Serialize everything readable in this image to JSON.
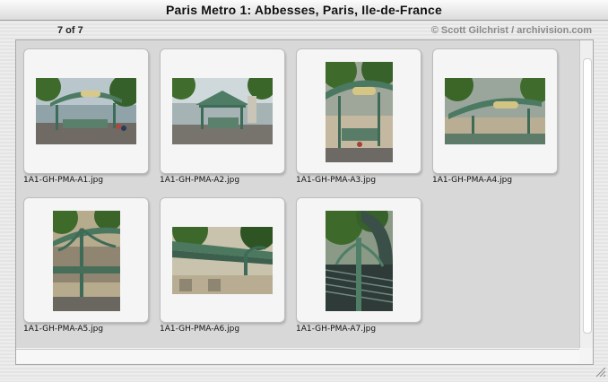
{
  "window": {
    "title": "Paris Metro 1: Abbesses, Paris, Ile-de-France"
  },
  "header": {
    "counter": "7 of 7",
    "copyright": "© Scott Gilchrist / archivision.com"
  },
  "gallery": {
    "items": [
      {
        "filename": "1A1-GH-PMA-A1.jpg",
        "orientation": "landscape",
        "icon": "photo-thumbnail-icon"
      },
      {
        "filename": "1A1-GH-PMA-A2.jpg",
        "orientation": "landscape",
        "icon": "photo-thumbnail-icon"
      },
      {
        "filename": "1A1-GH-PMA-A3.jpg",
        "orientation": "portrait",
        "icon": "photo-thumbnail-icon"
      },
      {
        "filename": "1A1-GH-PMA-A4.jpg",
        "orientation": "landscape",
        "icon": "photo-thumbnail-icon"
      },
      {
        "filename": "1A1-GH-PMA-A5.jpg",
        "orientation": "portrait",
        "icon": "photo-thumbnail-icon"
      },
      {
        "filename": "1A1-GH-PMA-A6.jpg",
        "orientation": "landscape",
        "icon": "photo-thumbnail-icon"
      },
      {
        "filename": "1A1-GH-PMA-A7.jpg",
        "orientation": "portrait",
        "icon": "photo-thumbnail-icon"
      }
    ]
  },
  "colors": {
    "background": "#e8e8e8",
    "gallery_background": "#d8d8d8",
    "card": "#f5f5f5",
    "metro_green": "#5f8a6c",
    "foliage": "#3f6b2a"
  }
}
